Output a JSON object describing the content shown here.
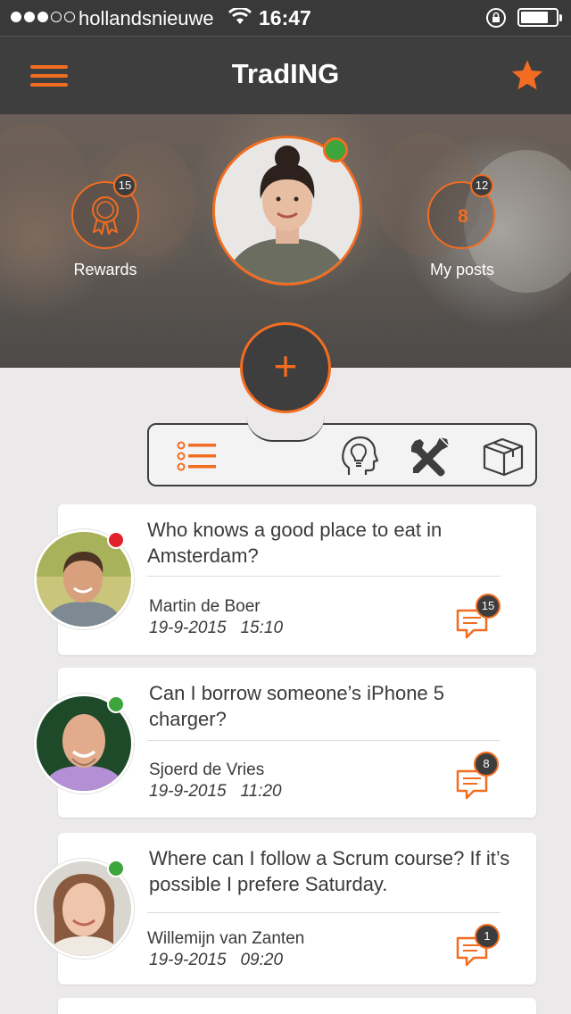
{
  "status_bar": {
    "carrier": "hollandsnieuwe",
    "time": "16:47",
    "signal_dots_filled": 3,
    "signal_dots_total": 5,
    "battery_level": 0.8
  },
  "nav": {
    "title": "TradING",
    "menu_icon": "hamburger-menu-icon",
    "favorite_icon": "star-icon"
  },
  "hero": {
    "rewards": {
      "label": "Rewards",
      "badge": "15",
      "icon": "award-ribbon-icon"
    },
    "my_posts": {
      "label": "My posts",
      "badge": "12",
      "count": "8"
    },
    "profile_status_color": "#3ca53c"
  },
  "add_button": {
    "label": "+"
  },
  "filters": [
    {
      "name": "list",
      "icon": "list-icon",
      "active": true
    },
    {
      "name": "ideas",
      "icon": "lightbulb-head-icon",
      "active": false
    },
    {
      "name": "tools",
      "icon": "tools-icon",
      "active": false
    },
    {
      "name": "items",
      "icon": "box-icon",
      "active": false
    }
  ],
  "posts": [
    {
      "question": "Who knows a good place to eat in Amsterdam?",
      "author": "Martin de Boer",
      "date": "19-9-2015",
      "time": "15:10",
      "comments": "15",
      "status": "busy"
    },
    {
      "question": "Can I borrow someone’s iPhone 5 charger?",
      "author": "Sjoerd de Vries",
      "date": "19-9-2015",
      "time": "11:20",
      "comments": "8",
      "status": "online"
    },
    {
      "question": "Where can I follow a Scrum course? If it’s possible I prefere Saturday.",
      "author": "Willemijn van Zanten",
      "date": "19-9-2015",
      "time": "09:20",
      "comments": "1",
      "status": "online"
    }
  ],
  "colors": {
    "accent": "#f26d21",
    "dark": "#3f3e3e",
    "online": "#3ca53c",
    "busy": "#e0232a",
    "background": "#ebe9e9"
  }
}
